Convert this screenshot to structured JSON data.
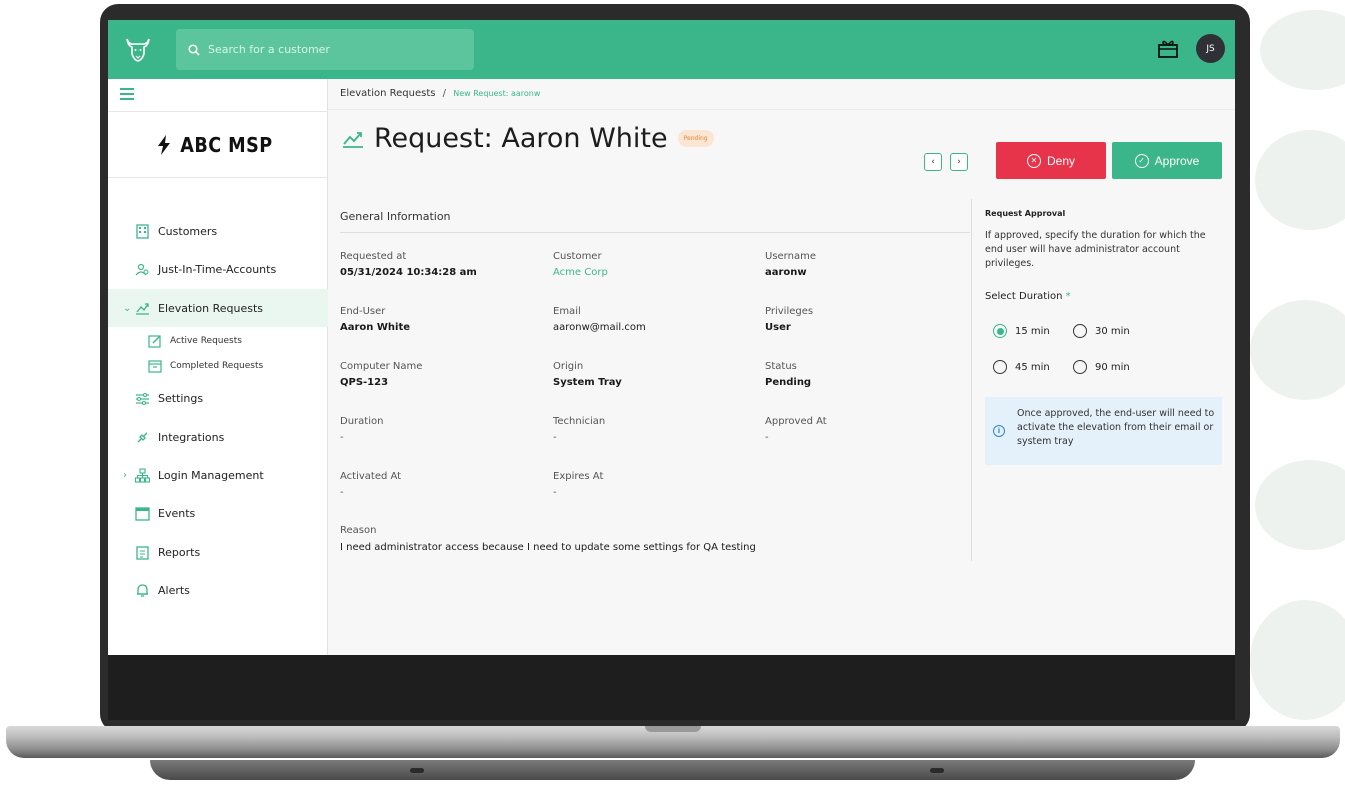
{
  "header": {
    "search_placeholder": "Search for a customer",
    "avatar_initials": "JS"
  },
  "sidebar": {
    "brand": "ABC MSP",
    "items": [
      {
        "label": "Customers"
      },
      {
        "label": "Just-In-Time-Accounts"
      },
      {
        "label": "Elevation Requests"
      },
      {
        "label": "Settings"
      },
      {
        "label": "Integrations"
      },
      {
        "label": "Login Management"
      },
      {
        "label": "Events"
      },
      {
        "label": "Reports"
      },
      {
        "label": "Alerts"
      }
    ],
    "sub_items": [
      {
        "label": "Active Requests"
      },
      {
        "label": "Completed Requests"
      }
    ]
  },
  "breadcrumb": {
    "parent": "Elevation Requests",
    "separator": "/",
    "current": "New Request: aaronw"
  },
  "page": {
    "title": "Request: Aaron White",
    "status_badge": "Pending",
    "deny_label": "Deny",
    "approve_label": "Approve"
  },
  "general": {
    "heading": "General Information",
    "fields": [
      {
        "label": "Requested at",
        "value": "05/31/2024 10:34:28 am"
      },
      {
        "label": "Customer",
        "value": "Acme Corp"
      },
      {
        "label": "Username",
        "value": "aaronw"
      },
      {
        "label": "End-User",
        "value": "Aaron White"
      },
      {
        "label": "Email",
        "value": "aaronw@mail.com"
      },
      {
        "label": "Privileges",
        "value": "User"
      },
      {
        "label": "Computer Name",
        "value": "QPS-123"
      },
      {
        "label": "Origin",
        "value": "System Tray"
      },
      {
        "label": "Status",
        "value": "Pending"
      },
      {
        "label": "Duration",
        "value": "-"
      },
      {
        "label": "Technician",
        "value": "-"
      },
      {
        "label": "Approved At",
        "value": "-"
      },
      {
        "label": "Activated At",
        "value": "-"
      },
      {
        "label": "Expires At",
        "value": "-"
      }
    ],
    "reason_label": "Reason",
    "reason_value": "I need administrator access because I need to update some settings for QA testing"
  },
  "approval": {
    "title": "Request Approval",
    "description": "If approved, specify the duration for which the end user will have administrator account privileges.",
    "duration_label": "Select Duration",
    "required_mark": "*",
    "options": [
      "15 min",
      "30 min",
      "45 min",
      "90 min"
    ],
    "selected": "15 min",
    "info": "Once approved, the end-user will need to activate the elevation from their email or system tray"
  },
  "colors": {
    "brand_green": "#3bb68a",
    "deny_red": "#e8344b",
    "info_blue": "#2f86d6",
    "pending_orange": "#e58a3a"
  }
}
